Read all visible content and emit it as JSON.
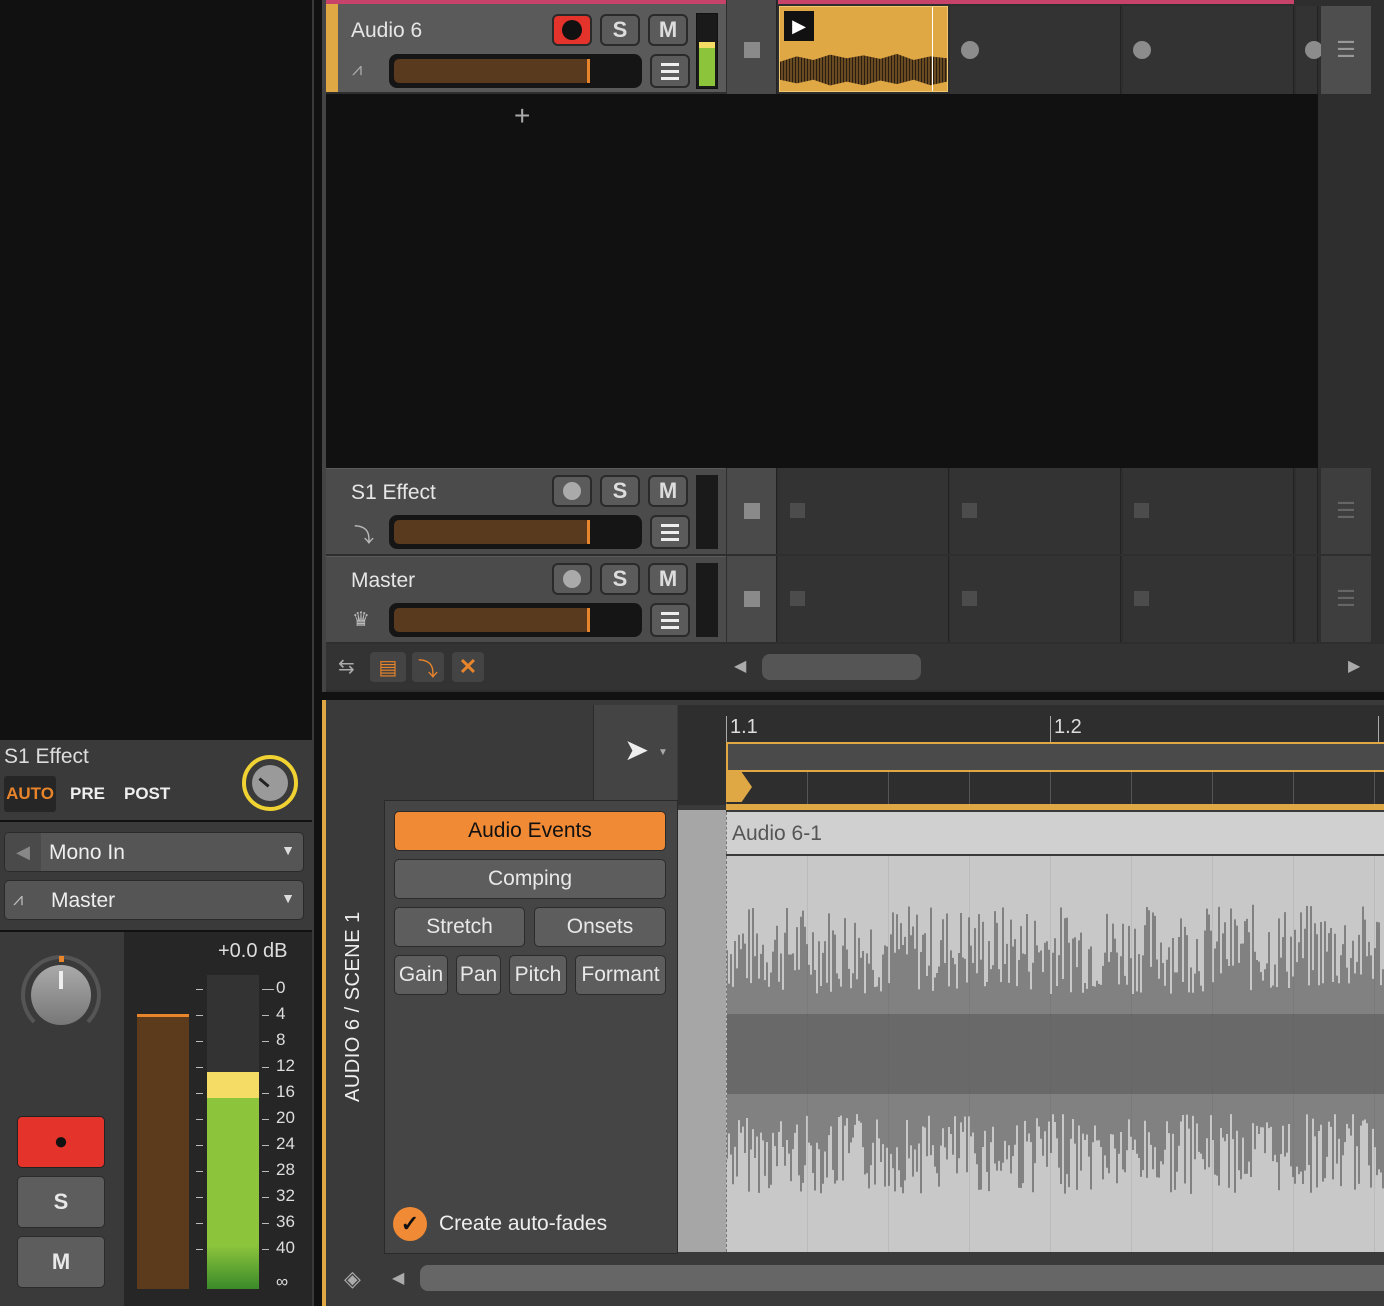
{
  "tracks": {
    "audio6": {
      "name": "Audio 6",
      "solo": "S",
      "mute": "M",
      "clip_color": "#e0a844"
    },
    "s1effect": {
      "name": "S1 Effect",
      "solo": "S",
      "mute": "M"
    },
    "master": {
      "name": "Master",
      "solo": "S",
      "mute": "M"
    },
    "add_track": "+"
  },
  "inspector": {
    "track_name": "S1 Effect",
    "modes": [
      "AUTO",
      "PRE",
      "POST"
    ],
    "input": "Mono In",
    "output": "Master",
    "level": "+0.0 dB",
    "meter_scale": [
      "0",
      "4",
      "8",
      "12",
      "16",
      "20",
      "24",
      "28",
      "32",
      "36",
      "40",
      "∞"
    ],
    "meter_level_fraction": 0.69,
    "record": "●",
    "solo": "S",
    "mute": "M"
  },
  "editor": {
    "title": "AUDIO 6 / SCENE 1",
    "ruler": [
      "1.1",
      "1.2"
    ],
    "clip_name": "Audio 6-1",
    "buttons": {
      "audio_events": "Audio Events",
      "comping": "Comping",
      "stretch": "Stretch",
      "onsets": "Onsets",
      "gain": "Gain",
      "pan": "Pan",
      "pitch": "Pitch",
      "formant": "Formant"
    },
    "auto_fades": "Create auto-fades"
  },
  "colors": {
    "accent": "#e8842a",
    "record": "#e3332b",
    "meter_green": "#8cc43c",
    "meter_yellow": "#f5dc64"
  }
}
